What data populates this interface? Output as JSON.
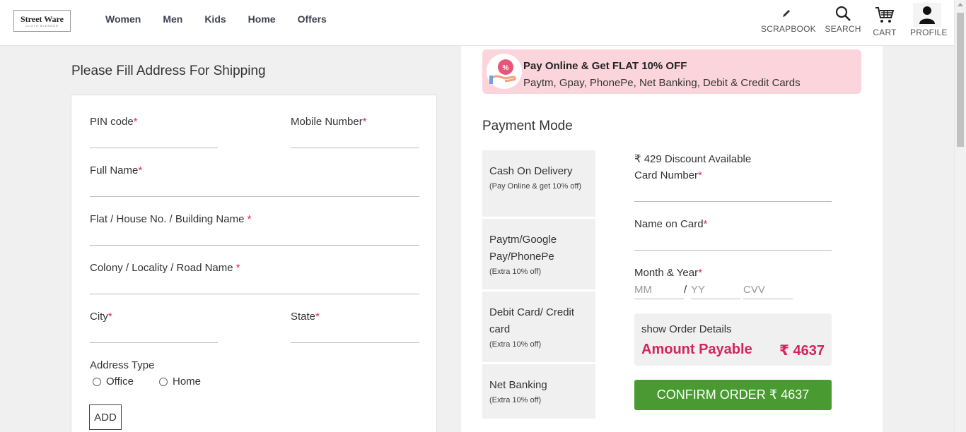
{
  "logo": {
    "name": "Street Ware",
    "tagline": "CLOTH BLENDER"
  },
  "nav": [
    "Women",
    "Men",
    "Kids",
    "Home",
    "Offers"
  ],
  "header_icons": {
    "scrapbook": "SCRAPBOOK",
    "search": "SEARCH",
    "cart": "CART",
    "profile": "PROFILE"
  },
  "shipping": {
    "title": "Please Fill Address For Shipping",
    "pin_label": "PIN code",
    "mobile_label": "Mobile Number",
    "fullname_label": "Full Name",
    "flat_label": "Flat / House No. / Building Name ",
    "colony_label": "Colony / Locality / Road Name ",
    "city_label": "City",
    "state_label": "State",
    "required_mark": "*",
    "address_type_label": "Address Type",
    "address_type_options": [
      "Office",
      "Home"
    ],
    "add_button": "ADD"
  },
  "promo": {
    "title": "Pay Online & Get FLAT 10% OFF",
    "subtitle": "Paytm, Gpay, PhonePe, Net Banking, Debit & Credit Cards"
  },
  "payment": {
    "title": "Payment Mode",
    "modes": [
      {
        "name": "Cash On Delivery",
        "note": "(Pay Online & get 10% off)"
      },
      {
        "name": "Paytm/Google Pay/PhonePe",
        "note": "(Extra 10% off)"
      },
      {
        "name": "Debit Card/ Credit card",
        "note": "(Extra 10% off)"
      },
      {
        "name": "Net Banking",
        "note": "(Extra 10% off)"
      }
    ],
    "discount_text": "₹ 429 Discount Available",
    "card_number_label": "Card Number",
    "name_on_card_label": "Name on Card",
    "month_year_label": "Month & Year",
    "mm_placeholder": "MM",
    "yy_placeholder": "YY",
    "cvv_placeholder": "CVV",
    "separator": "/",
    "show_order_details": "show Order Details",
    "amount_payable_label": "Amount Payable",
    "amount_payable_value": "₹ 4637",
    "confirm_button": "CONFIRM ORDER ₹ 4637"
  },
  "colors": {
    "accent": "#d3245c",
    "confirm": "#4a9a32",
    "promo_bg": "#fcd5dc"
  }
}
